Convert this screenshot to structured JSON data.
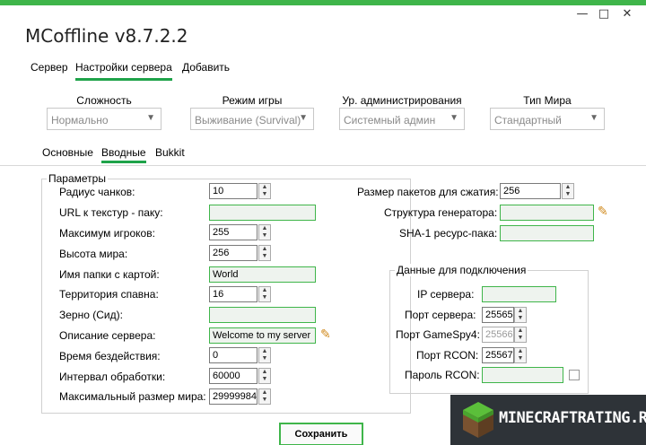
{
  "window": {
    "title": "MCoffline v8.7.2.2",
    "minimize": "—",
    "maximize": "□",
    "close": "✕"
  },
  "tabs": [
    "Сервер",
    "Настройки сервера",
    "Добавить"
  ],
  "dropdowns": [
    {
      "label": "Сложность",
      "value": "Нормально"
    },
    {
      "label": "Режим игры",
      "value": "Выживание (Survival)"
    },
    {
      "label": "Ур. администрирования",
      "value": "Системный админ"
    },
    {
      "label": "Тип Мира",
      "value": "Стандартный"
    }
  ],
  "subtabs": [
    "Основные",
    "Вводные",
    "Bukkit"
  ],
  "params": {
    "legend": "Параметры",
    "fields": [
      {
        "label": "Радиус чанков:",
        "value": "10"
      },
      {
        "label": "URL к текстур - паку:",
        "value": ""
      },
      {
        "label": "Максимум игроков:",
        "value": "255"
      },
      {
        "label": "Высота мира:",
        "value": "256"
      },
      {
        "label": "Имя папки с картой:",
        "value": "World"
      },
      {
        "label": "Территория спавна:",
        "value": "16"
      },
      {
        "label": "Зерно (Сид):",
        "value": ""
      },
      {
        "label": "Описание сервера:",
        "value": "Welcome to my server"
      },
      {
        "label": "Время бездействия:",
        "value": "0"
      },
      {
        "label": "Интервал обработки:",
        "value": "60000"
      },
      {
        "label": "Максимальный размер мира:",
        "value": "29999984"
      }
    ],
    "right_fields": [
      {
        "label": "Размер пакетов для сжатия:",
        "value": "256"
      },
      {
        "label": "Структура генератора:",
        "value": ""
      },
      {
        "label": "SHA-1 ресурс-пака:",
        "value": ""
      }
    ]
  },
  "connection": {
    "legend": "Данные для подключения",
    "fields": [
      {
        "label": "IP сервера:",
        "value": ""
      },
      {
        "label": "Порт сервера:",
        "value": "25565"
      },
      {
        "label": "Порт GameSpy4:",
        "value": "25566"
      },
      {
        "label": "Порт RCON:",
        "value": "25567"
      },
      {
        "label": "Пароль RCON:",
        "value": ""
      }
    ]
  },
  "save_label": "Сохранить",
  "watermark": "MINECRAFTRATING.RU",
  "colors": {
    "accent": "#3fb54a",
    "text_field_bg": "#eef3ee"
  }
}
